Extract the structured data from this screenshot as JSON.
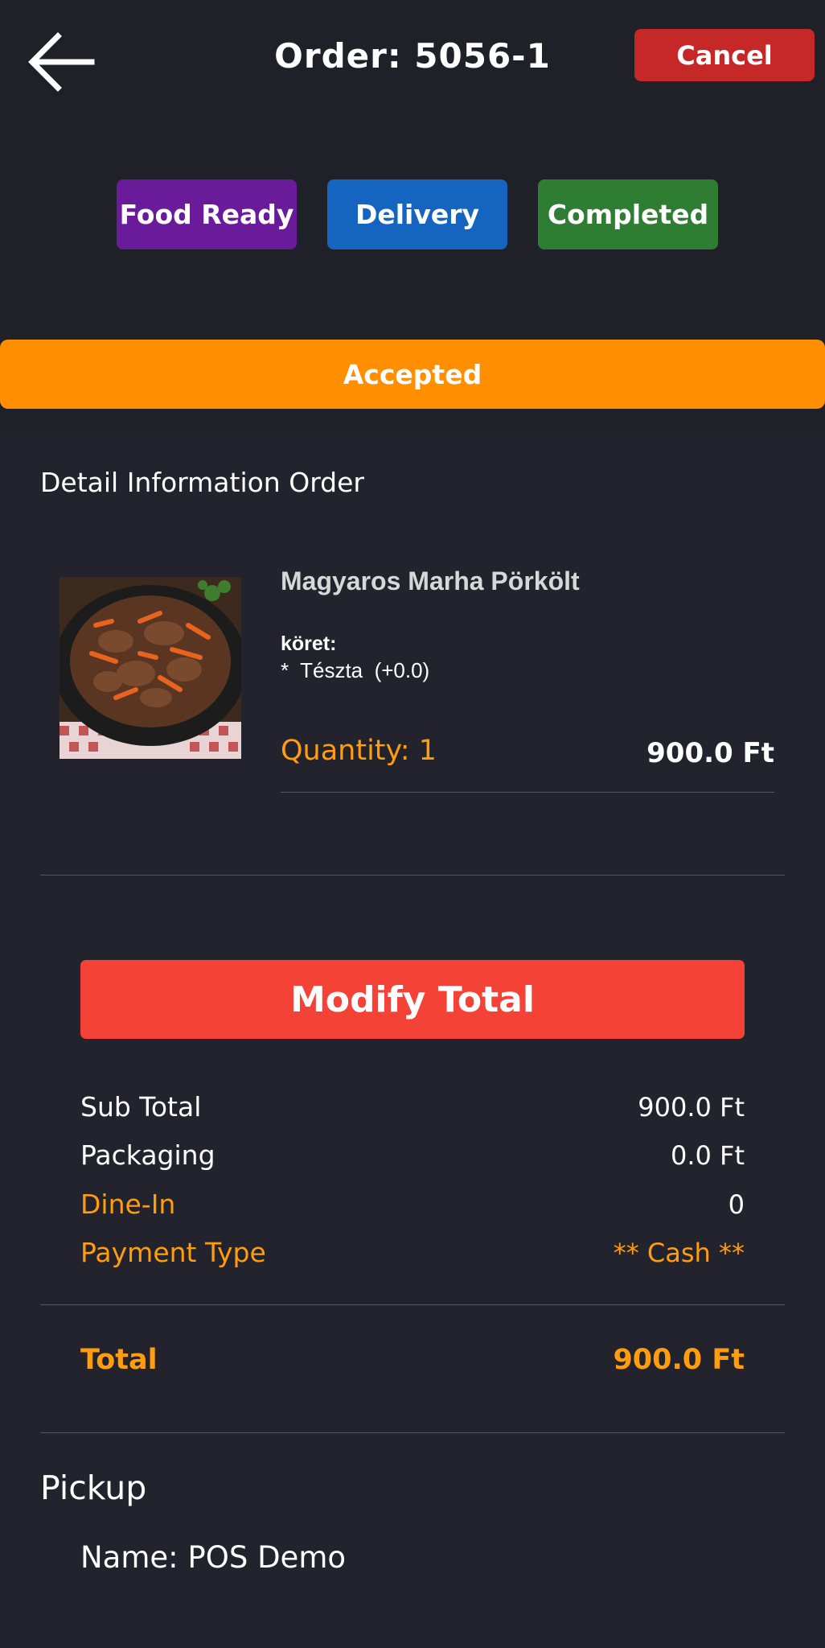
{
  "header": {
    "title": "Order:  5056-1",
    "cancel_label": "Cancel",
    "back_icon": "arrow-left-icon"
  },
  "status_buttons": [
    {
      "label": "Food Ready",
      "color": "#6a1b9a"
    },
    {
      "label": "Delivery",
      "color": "#1565c0"
    },
    {
      "label": "Completed",
      "color": "#2e7d32"
    }
  ],
  "current_status": {
    "label": "Accepted",
    "color": "#ff8f00"
  },
  "detail": {
    "heading": "Detail Information Order",
    "item": {
      "name": "Magyaros Marha Pörkölt",
      "option_group": "köret:",
      "option": "*  Tészta  (+0.0)",
      "quantity": "Quantity: 1",
      "price": "900.0 Ft"
    }
  },
  "modify_total_label": "Modify Total",
  "summary": {
    "subtotal_label": "Sub Total",
    "subtotal_value": "900.0 Ft",
    "packaging_label": "Packaging",
    "packaging_value": "0.0 Ft",
    "dinein_label": "Dine-In",
    "dinein_value": "0",
    "payment_label": "Payment Type",
    "payment_value": "** Cash **",
    "total_label": "Total",
    "total_value": "900.0 Ft"
  },
  "pickup": {
    "title": "Pickup",
    "name": "Name: POS Demo"
  },
  "colors": {
    "background": "#22232c",
    "accent_orange": "#ff9d0f",
    "modify_red": "#f44336",
    "cancel_red": "#c62828"
  }
}
